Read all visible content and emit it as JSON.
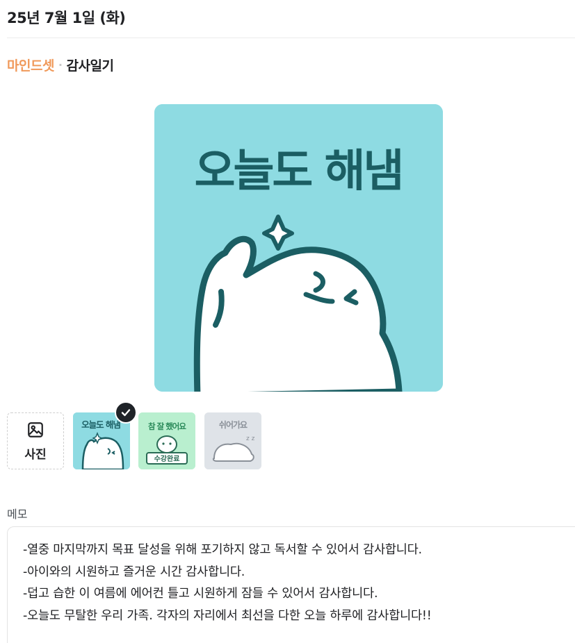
{
  "date": "25년 7월 1일 (화)",
  "breadcrumb": {
    "brand": "마인드셋",
    "separator": "·",
    "page": "감사일기"
  },
  "main_image": {
    "text": "오늘도 해냄",
    "background_color": "#8edbe2",
    "ink_color": "#1b5e63"
  },
  "photo_button": {
    "icon": "image-icon",
    "label": "사진"
  },
  "stickers": [
    {
      "text": "오늘도 해냄",
      "selected": true,
      "background_color": "#8edbe2"
    },
    {
      "text": "참 잘 했어요",
      "caption": "수강완료",
      "selected": false,
      "background_color": "#b9efcf"
    },
    {
      "text": "쉬어가요",
      "selected": false,
      "background_color": "#dfe3e8"
    }
  ],
  "memo": {
    "label": "메모",
    "lines": [
      "-열중 마지막까지 목표 달성을 위해 포기하지 않고 독서할 수 있어서 감사합니다.",
      "-아이와의 시원하고 즐거운 시간 감사합니다.",
      "-덥고 습한 이 여름에 에어컨 틀고 시원하게 잠들 수 있어서 감사합니다.",
      "-오늘도 무탈한 우리 가족. 각자의 자리에서 최선을 다한 오늘 하루에 감사합니다!!"
    ]
  },
  "colors": {
    "brand": "#f0995a",
    "selected_badge": "#1f2328"
  }
}
